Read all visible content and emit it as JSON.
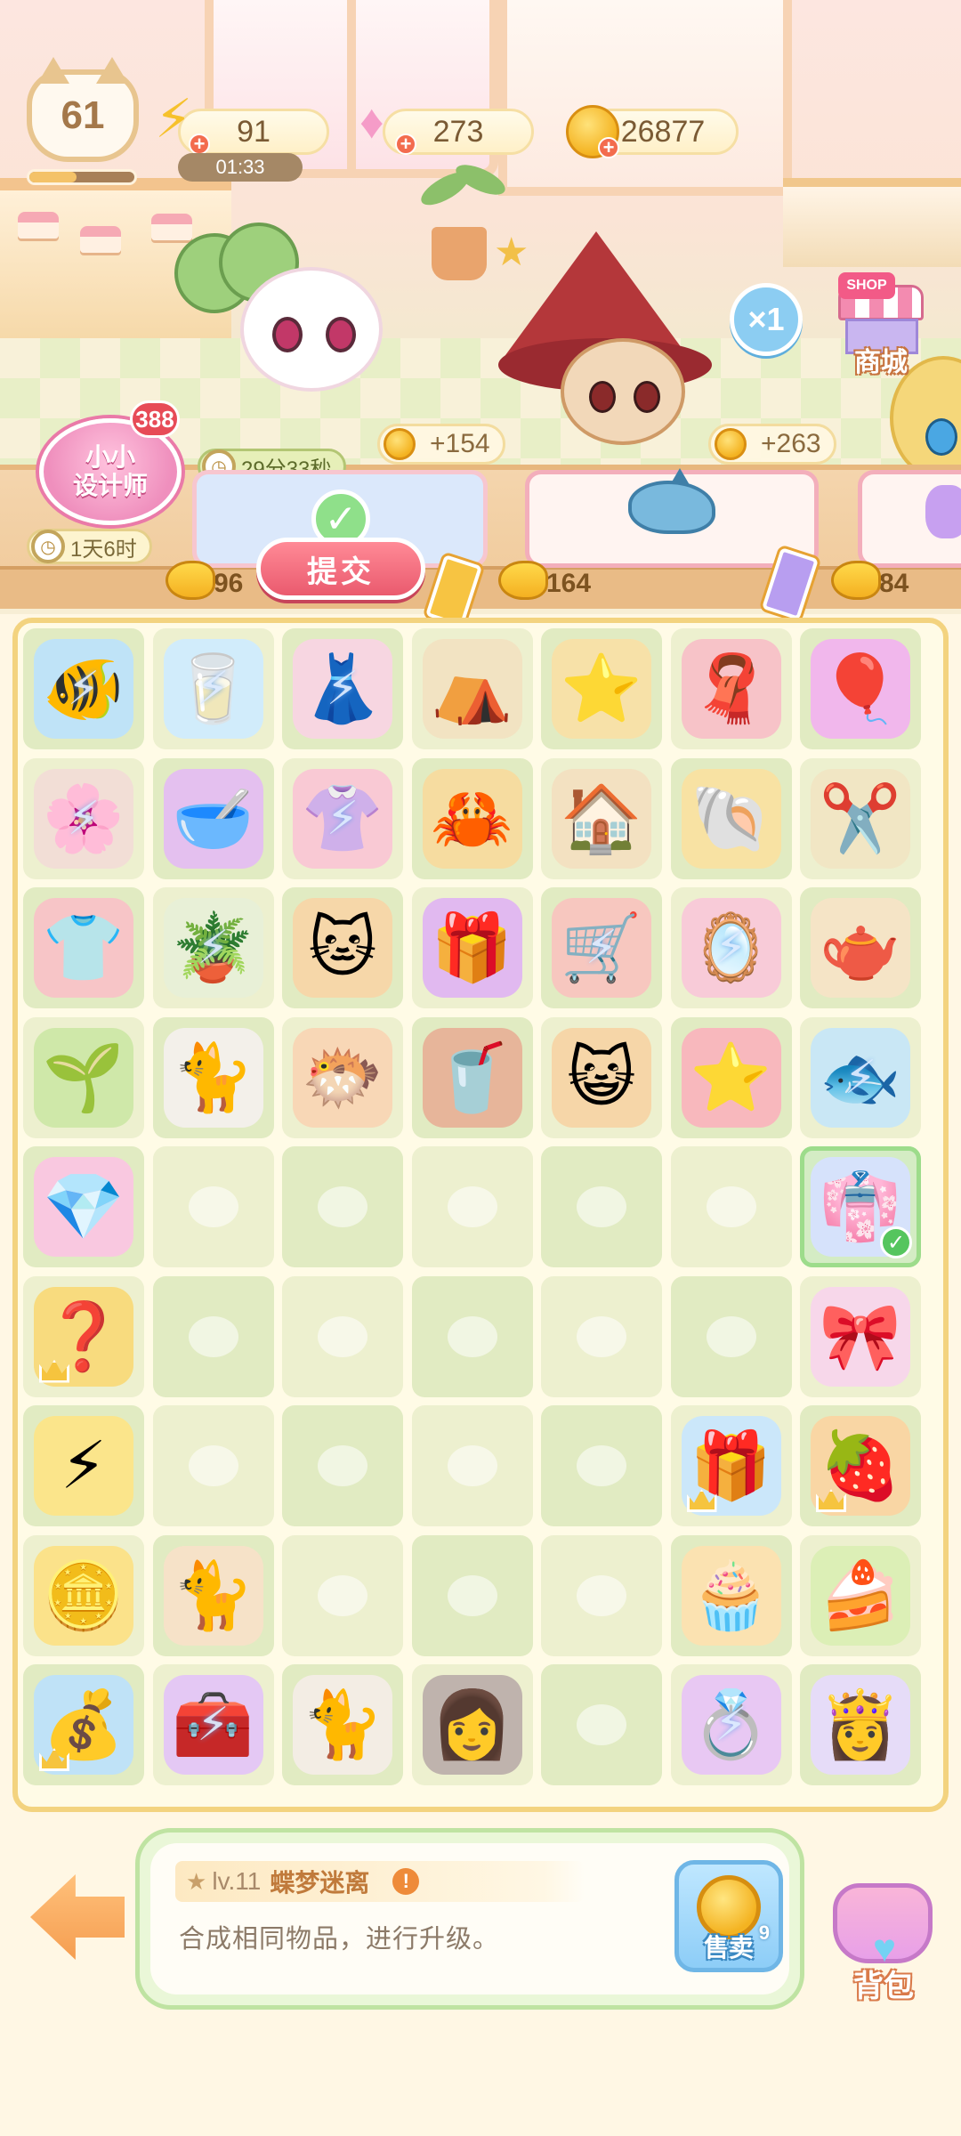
{
  "hud": {
    "level": "61",
    "level_progress": 0.45,
    "energy": {
      "value": "91",
      "timer": "01:33",
      "icon": "lightning-icon"
    },
    "gems": {
      "value": "273",
      "icon": "gem-icon"
    },
    "coins": {
      "value": "26877",
      "icon": "coin-icon"
    }
  },
  "scene": {
    "multiplier_label": "×1",
    "shop_tag": "SHOP",
    "shop_label": "商城",
    "reward_1": "+154",
    "reward_2": "+263"
  },
  "orders": {
    "designer_line1": "小小",
    "designer_line2": "设计师",
    "designer_count": "388",
    "designer_timer": "1天6时",
    "order_timer": "29分33秒",
    "submit_label": "提交",
    "fish_counts": [
      "96",
      "164",
      "84"
    ]
  },
  "board": {
    "rows": [
      [
        {
          "name": "fishbowl",
          "glyph": "🐠",
          "locked": true,
          "bg": "#bfe3f7"
        },
        {
          "name": "water-glass",
          "glyph": "🥛",
          "locked": true,
          "bg": "#d1ecfb"
        },
        {
          "name": "clothes-rack",
          "glyph": "👗",
          "locked": true,
          "bg": "#f7d6e1"
        },
        {
          "name": "tent",
          "glyph": "⛺",
          "locked": false,
          "bg": "#f2e3c2"
        },
        {
          "name": "sand-pile",
          "glyph": "⭐",
          "locked": false,
          "bg": "#f7e1a8"
        },
        {
          "name": "towel",
          "glyph": "🧣",
          "locked": false,
          "bg": "#f7c3c8"
        },
        {
          "name": "pink-ball",
          "glyph": "🎈",
          "locked": false,
          "bg": "#f1b7ec"
        }
      ],
      [
        {
          "name": "flower-shelf",
          "glyph": "🌸",
          "locked": true,
          "bg": "#f2ded6"
        },
        {
          "name": "pet-bowl",
          "glyph": "🥣",
          "locked": false,
          "bg": "#e4c0ef"
        },
        {
          "name": "dress-stand",
          "glyph": "👚",
          "locked": true,
          "bg": "#f9c9d4"
        },
        {
          "name": "crab-sign",
          "glyph": "🦀",
          "locked": false,
          "bg": "#f6dca0"
        },
        {
          "name": "house",
          "glyph": "🏠",
          "locked": false,
          "bg": "#f3e1c1"
        },
        {
          "name": "shell-sand",
          "glyph": "🐚",
          "locked": false,
          "bg": "#f8e2a3"
        },
        {
          "name": "scissors",
          "glyph": "✂️",
          "locked": false,
          "bg": "#f1e6c4"
        }
      ],
      [
        {
          "name": "hanger",
          "glyph": "👕",
          "locked": false,
          "bg": "#f7c5c7"
        },
        {
          "name": "flower-cabinet",
          "glyph": "🪴",
          "locked": true,
          "bg": "#e8f0d7"
        },
        {
          "name": "lucky-cat",
          "glyph": "🐱",
          "locked": false,
          "bg": "#f6d7a9"
        },
        {
          "name": "purple-box",
          "glyph": "🎁",
          "locked": false,
          "bg": "#e1b9f0"
        },
        {
          "name": "cart",
          "glyph": "🛒",
          "locked": true,
          "bg": "#f7c7bf"
        },
        {
          "name": "curtain-frame",
          "glyph": "🪞",
          "locked": true,
          "bg": "#f8cbd8"
        },
        {
          "name": "watering-pot",
          "glyph": "🫖",
          "locked": false,
          "bg": "#f5e4c6"
        }
      ],
      [
        {
          "name": "sprout",
          "glyph": "🌱",
          "locked": false,
          "bg": "#cfe8a9"
        },
        {
          "name": "white-cat",
          "glyph": "🐈",
          "locked": false,
          "bg": "#f3f0ea"
        },
        {
          "name": "pufferfish",
          "glyph": "🐡",
          "locked": false,
          "bg": "#f8d7b6"
        },
        {
          "name": "cola-glass",
          "glyph": "🥤",
          "locked": false,
          "bg": "#e7b59a"
        },
        {
          "name": "cat-head",
          "glyph": "😺",
          "locked": false,
          "bg": "#f6d6a8"
        },
        {
          "name": "starfish",
          "glyph": "⭐",
          "locked": false,
          "bg": "#f8b8bd"
        },
        {
          "name": "fishbowl-small",
          "glyph": "🐟",
          "locked": true,
          "bg": "#c9e7f5"
        }
      ],
      [
        {
          "name": "pink-gems",
          "glyph": "💎",
          "locked": false,
          "bg": "#f9c8e0"
        },
        null,
        null,
        null,
        null,
        null,
        {
          "name": "blue-dress",
          "glyph": "👘",
          "locked": false,
          "bg": "#d6e2fb",
          "selected": true
        }
      ],
      [
        {
          "name": "mystery-box",
          "glyph": "❓",
          "locked": false,
          "bg": "#f8db7e",
          "crown": true
        },
        null,
        null,
        null,
        null,
        null,
        {
          "name": "headband",
          "glyph": "🎀",
          "locked": false,
          "bg": "#f7d7ea"
        }
      ],
      [
        {
          "name": "energy-bolts",
          "glyph": "⚡",
          "locked": false,
          "bg": "#fbe58b"
        },
        null,
        null,
        null,
        null,
        {
          "name": "blue-gift",
          "glyph": "🎁",
          "locked": false,
          "bg": "#cbe7fa",
          "crown": true
        },
        {
          "name": "fruit-tart",
          "glyph": "🍓",
          "locked": false,
          "bg": "#f9d6a4",
          "crown": true
        }
      ],
      [
        {
          "name": "coin-pile",
          "glyph": "🪙",
          "locked": false,
          "bg": "#fbe28a"
        },
        {
          "name": "calico-cat",
          "glyph": "🐈",
          "locked": false,
          "bg": "#f6e2c8"
        },
        null,
        null,
        null,
        {
          "name": "cream-puff",
          "glyph": "🧁",
          "locked": false,
          "bg": "#fbe2b1"
        },
        {
          "name": "matcha-cake",
          "glyph": "🍰",
          "locked": false,
          "bg": "#dcefb6"
        }
      ],
      [
        {
          "name": "treasure-chest",
          "glyph": "💰",
          "locked": false,
          "bg": "#bfe2f7",
          "crown": true
        },
        {
          "name": "purple-chest",
          "glyph": "🧰",
          "locked": true,
          "bg": "#e4c8f4"
        },
        {
          "name": "sitting-cat",
          "glyph": "🐈",
          "locked": false,
          "bg": "#f3ede4"
        },
        {
          "name": "hair-wig",
          "glyph": "👩",
          "locked": false,
          "bg": "#bfb3ad"
        },
        null,
        {
          "name": "jewelry-box",
          "glyph": "💍",
          "locked": true,
          "bg": "#e8c8f3"
        },
        {
          "name": "lilac-wig",
          "glyph": "👸",
          "locked": false,
          "bg": "#e6dcf8"
        }
      ]
    ]
  },
  "info": {
    "level_text": "lv.11",
    "item_name": "蝶梦迷离",
    "description": "合成相同物品，进行升级。",
    "info_icon": "!"
  },
  "sell": {
    "label": "售卖",
    "price": "9"
  },
  "bag": {
    "label": "背包"
  },
  "colors": {
    "accent_pink": "#ea5a6e",
    "board_border": "#f3d37f",
    "cell_green": "#e1ebc2"
  }
}
